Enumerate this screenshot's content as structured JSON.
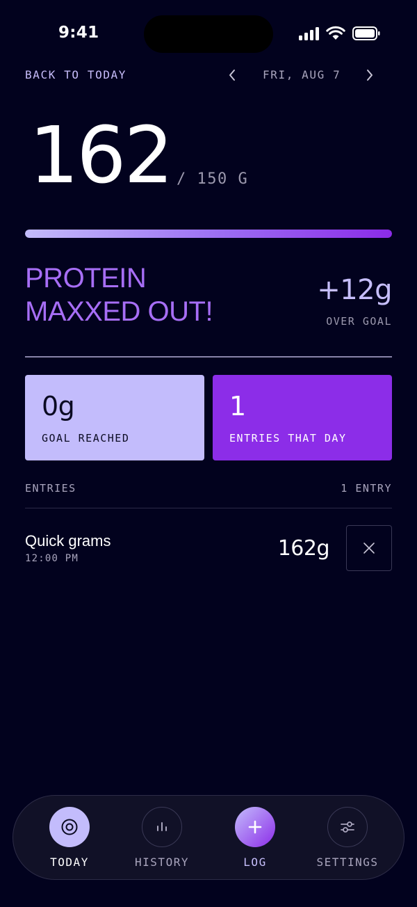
{
  "status_bar": {
    "time": "9:41"
  },
  "header": {
    "back_label": "BACK TO TODAY",
    "date_label": "FRI, AUG 7"
  },
  "summary": {
    "total": "162",
    "goal_text": "/ 150 G",
    "progress_fraction": 1.0,
    "headline_line1": "PROTEIN",
    "headline_line2": "MAXXED OUT!",
    "over_amount": "+12g",
    "over_label": "OVER GOAL"
  },
  "cards": {
    "goal": {
      "value": "0g",
      "label": "GOAL REACHED"
    },
    "entries": {
      "value": "1",
      "label": "ENTRIES THAT DAY"
    }
  },
  "entries_section": {
    "title": "ENTRIES",
    "count": "1 ENTRY",
    "items": [
      {
        "name": "Quick grams",
        "time": "12:00 PM",
        "amount": "162g"
      }
    ]
  },
  "tabs": [
    {
      "label": "TODAY",
      "icon": "target-icon",
      "active": true
    },
    {
      "label": "HISTORY",
      "icon": "bar-chart-icon"
    },
    {
      "label": "LOG",
      "icon": "plus-icon"
    },
    {
      "label": "SETTINGS",
      "icon": "sliders-icon"
    }
  ],
  "colors": {
    "background": "#02021e",
    "accent_purple": "#8c2de8",
    "accent_lavender": "#c3bcfc",
    "headline": "#a76ef6"
  }
}
